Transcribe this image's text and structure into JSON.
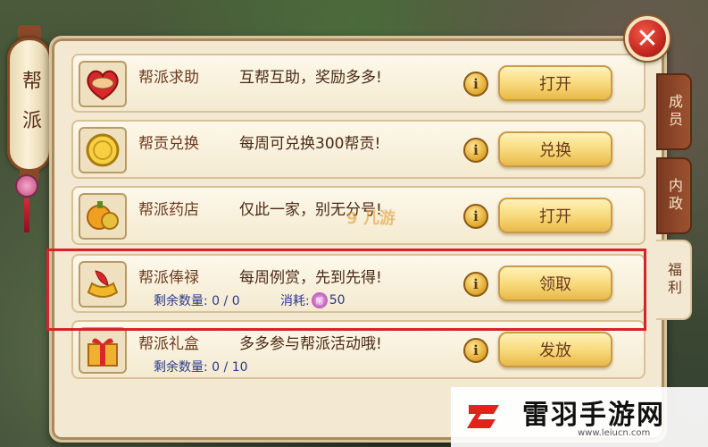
{
  "lantern": {
    "chars": [
      "帮",
      "派"
    ]
  },
  "close": {
    "glyph": "✕"
  },
  "tabs": [
    {
      "label": "成员",
      "active": false
    },
    {
      "label": "内政",
      "active": false
    },
    {
      "label": "福利",
      "active": true
    }
  ],
  "rows": [
    {
      "icon": "handshake-heart-icon",
      "title": "帮派求助",
      "desc": "互帮互助，奖励多多!",
      "button": "打开",
      "sub": "",
      "sub2_label": "",
      "sub2_value": ""
    },
    {
      "icon": "gold-coin-icon",
      "title": "帮贡兑换",
      "desc": "每周可兑换300帮贡!",
      "button": "兑换",
      "sub": "",
      "sub2_label": "",
      "sub2_value": ""
    },
    {
      "icon": "gold-treasure-icon",
      "title": "帮派药店",
      "desc": "仅此一家，别无分号!",
      "button": "打开",
      "sub": "",
      "sub2_label": "",
      "sub2_value": ""
    },
    {
      "icon": "gold-ingot-icon",
      "title": "帮派俸禄",
      "desc": "每周例赏，先到先得!",
      "button": "领取",
      "sub": "剩余数量: 0 / 0",
      "sub2_label": "消耗:",
      "sub2_gem": "帮",
      "sub2_value": "50"
    },
    {
      "icon": "gift-box-icon",
      "title": "帮派礼盒",
      "desc": "多多参与帮派活动哦!",
      "button": "发放",
      "sub": "剩余数量: 0 / 10",
      "sub2_label": "",
      "sub2_value": ""
    }
  ],
  "info_glyph": "i",
  "mid_watermark": "9 几游",
  "watermark": {
    "text": "雷羽手游网",
    "url": "www.leiucn.com"
  },
  "colors": {
    "panel": "#f3e9d3",
    "button": "#f7d878",
    "highlight": "#d8222a",
    "close": "#c4281e"
  }
}
